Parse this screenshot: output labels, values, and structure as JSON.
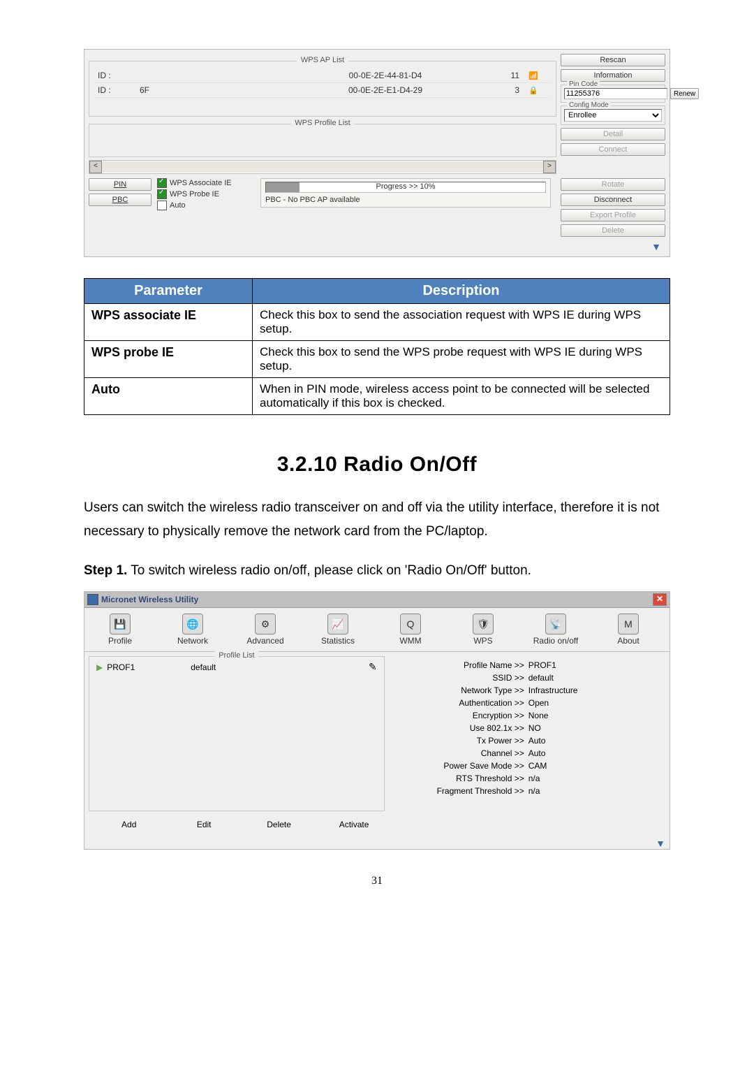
{
  "wps": {
    "ap_list_title": "WPS AP List",
    "id_label": "ID :",
    "rows": [
      {
        "id": "ID :",
        "rate": "",
        "mac": "00-0E-2E-44-81-D4",
        "ch": "11"
      },
      {
        "id": "ID :",
        "rate": "6F",
        "mac": "00-0E-2E-E1-D4-29",
        "ch": "3"
      }
    ],
    "profile_list_title": "WPS Profile List",
    "rescan": "Rescan",
    "information": "Information",
    "pin_code_title": "Pin Code",
    "pin_value": "11255376",
    "renew": "Renew",
    "config_mode_title": "Config Mode",
    "config_value": "Enrollee",
    "detail": "Detail",
    "connect": "Connect",
    "rotate": "Rotate",
    "disconnect": "Disconnect",
    "export_profile": "Export Profile",
    "delete": "Delete",
    "pin_btn": "PIN",
    "pbc_btn": "PBC",
    "wps_assoc": "WPS Associate IE",
    "wps_probe": "WPS Probe IE",
    "auto": "Auto",
    "progress_label": "Progress >> 10%",
    "status": "PBC - No PBC AP available"
  },
  "paramTable": {
    "head1": "Parameter",
    "head2": "Description",
    "rows": [
      {
        "p": "WPS associate IE",
        "d": "Check this box to send the association request with WPS IE during WPS setup."
      },
      {
        "p": "WPS probe IE",
        "d": "Check this box to send the WPS probe request with WPS IE during WPS setup."
      },
      {
        "p": "Auto",
        "d": "When in PIN mode, wireless access point to be connected will be selected automatically if this box is checked."
      }
    ]
  },
  "heading": "3.2.10   Radio On/Off",
  "body": "Users can switch the wireless radio transceiver on and off via the utility interface, therefore it is not necessary to physically remove the network card from the PC/laptop.",
  "step1_prefix": "Step 1.",
  "step1_rest": " To switch wireless radio on/off, please click on 'Radio On/Off' button.",
  "utility": {
    "title": "Micronet Wireless Utility",
    "tabs": [
      "Profile",
      "Network",
      "Advanced",
      "Statistics",
      "WMM",
      "WPS",
      "Radio on/off",
      "About"
    ],
    "profile_list_title": "Profile List",
    "profile_name": "PROF1",
    "profile_ssid": "default",
    "details": [
      {
        "l": "Profile Name >>",
        "v": "PROF1"
      },
      {
        "l": "SSID >>",
        "v": "default"
      },
      {
        "l": "Network Type >>",
        "v": "Infrastructure"
      },
      {
        "l": "Authentication >>",
        "v": "Open"
      },
      {
        "l": "Encryption >>",
        "v": "None"
      },
      {
        "l": "Use 802.1x >>",
        "v": "NO"
      },
      {
        "l": "Tx Power >>",
        "v": "Auto"
      },
      {
        "l": "Channel >>",
        "v": "Auto"
      },
      {
        "l": "Power Save Mode >>",
        "v": "CAM"
      },
      {
        "l": "RTS Threshold >>",
        "v": "n/a"
      },
      {
        "l": "Fragment Threshold >>",
        "v": "n/a"
      }
    ],
    "actions": [
      "Add",
      "Edit",
      "Delete",
      "Activate"
    ]
  },
  "pagenum": "31"
}
